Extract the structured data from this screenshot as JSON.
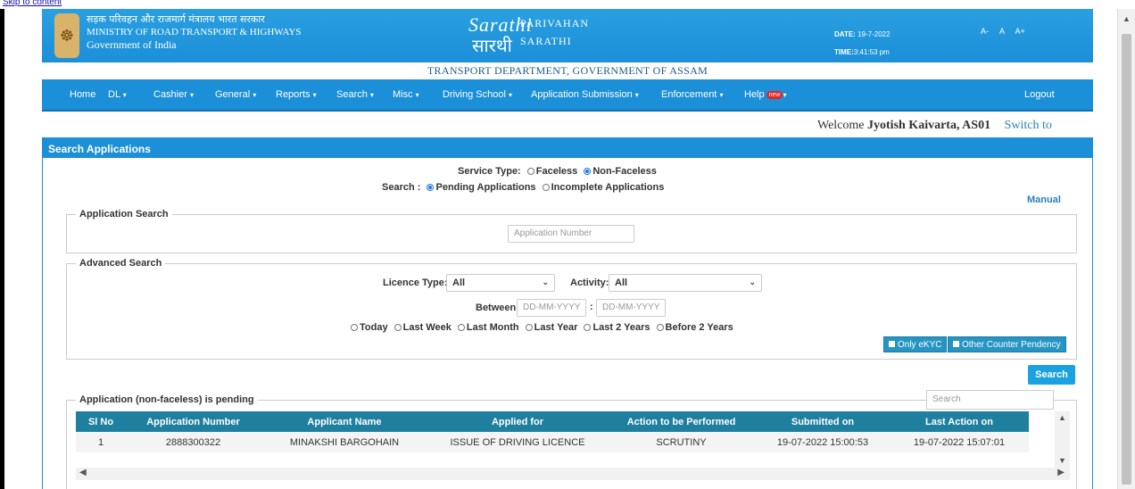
{
  "topbar_link": "Skip to content",
  "header": {
    "hindi": "सड़क परिवहन और राजमार्ग मंत्रालय भारत सरकार",
    "ministry": "MINISTRY OF ROAD TRANSPORT & HIGHWAYS",
    "gov": "Government of India",
    "logo_text1": "PARIVAHAN",
    "logo_text2": "SARATHI",
    "logo_mark": "Sarathi",
    "logo_mark2": "सारथी",
    "date_label": "DATE:",
    "date_value": "19-7-2022",
    "time_label": "TIME:",
    "time_value": "3:41:53 pm",
    "font_small": "A-",
    "font_normal": "A",
    "font_large": "A+"
  },
  "department": "TRANSPORT DEPARTMENT, GOVERNMENT OF ASSAM",
  "nav": {
    "items": [
      "Home",
      "DL",
      "Cashier",
      "General",
      "Reports",
      "Search",
      "Misc",
      "Driving School",
      "Application Submission",
      "Enforcement",
      "Help"
    ],
    "new_badge": "new",
    "logout": "Logout"
  },
  "welcome": {
    "prefix": "Welcome",
    "user": "Jyotish Kaivarta, AS01",
    "switch": "Switch to"
  },
  "panel_title": "Search Applications",
  "service_type": {
    "label": "Service Type:",
    "options": [
      "Faceless",
      "Non-Faceless"
    ],
    "selected": "Non-Faceless"
  },
  "search_mode": {
    "label": "Search :",
    "options": [
      "Pending Applications",
      "Incomplete Applications"
    ],
    "selected": "Pending Applications"
  },
  "manual_link": "Manual",
  "application_search": {
    "legend": "Application Search",
    "placeholder": "Application Number"
  },
  "advanced_search": {
    "legend": "Advanced Search",
    "licence_label": "Licence Type:",
    "licence_value": "All",
    "activity_label": "Activity:",
    "activity_value": "All",
    "between_label": "Between",
    "date_placeholder": "DD-MM-YYYY",
    "range_sep": ":",
    "periods": [
      "Today",
      "Last Week",
      "Last Month",
      "Last Year",
      "Last 2 Years",
      "Before 2 Years"
    ],
    "only_ekyc": "Only eKYC",
    "other_counter": "Other Counter Pendency"
  },
  "search_button": "Search",
  "results": {
    "legend": "Application (non-faceless) is pending",
    "search_placeholder": "Search",
    "columns": [
      "Sl No",
      "Application Number",
      "Applicant Name",
      "Applied for",
      "Action to be Performed",
      "Submitted on",
      "Last Action on"
    ],
    "rows": [
      [
        "1",
        "2888300322",
        "MINAKSHI BARGOHAIN",
        "ISSUE OF DRIVING LICENCE",
        "SCRUTINY",
        "19-07-2022 15:00:53",
        "19-07-2022 15:07:01"
      ]
    ]
  }
}
